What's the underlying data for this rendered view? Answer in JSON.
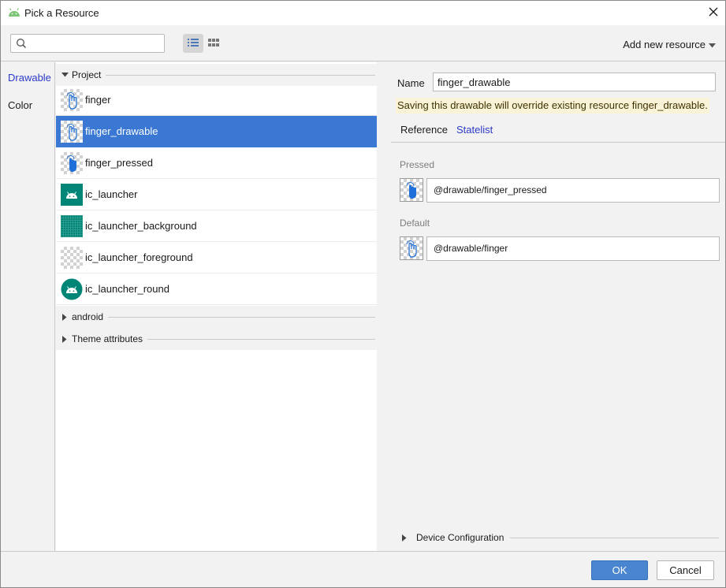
{
  "window": {
    "title": "Pick a Resource",
    "close_icon": "close-icon",
    "app_icon": "android-icon"
  },
  "toolbar": {
    "search": {
      "value": "",
      "placeholder": ""
    },
    "view_list_icon": "list-view-icon",
    "view_grid_icon": "grid-view-icon",
    "add_new_label": "Add new resource"
  },
  "sidebar": {
    "items": [
      {
        "label": "Drawable",
        "selected": true
      },
      {
        "label": "Color",
        "selected": false
      }
    ]
  },
  "resources": {
    "groups": [
      {
        "label": "Project",
        "expanded": true,
        "items": [
          {
            "name": "finger",
            "icon": "finger-outline-icon",
            "selected": false
          },
          {
            "name": "finger_drawable",
            "icon": "finger-outline-icon",
            "selected": true
          },
          {
            "name": "finger_pressed",
            "icon": "finger-pressed-icon",
            "selected": false
          },
          {
            "name": "ic_launcher",
            "icon": "android-launcher-icon",
            "selected": false
          },
          {
            "name": "ic_launcher_background",
            "icon": "grid-background-icon",
            "selected": false
          },
          {
            "name": "ic_launcher_foreground",
            "icon": "transparent-foreground-icon",
            "selected": false
          },
          {
            "name": "ic_launcher_round",
            "icon": "android-round-icon",
            "selected": false
          }
        ]
      },
      {
        "label": "android",
        "expanded": false
      },
      {
        "label": "Theme attributes",
        "expanded": false
      }
    ]
  },
  "detail": {
    "name_label": "Name",
    "name_value": "finger_drawable",
    "warning": "Saving this drawable will override existing resource finger_drawable.",
    "tabs": [
      {
        "label": "Reference",
        "active": false
      },
      {
        "label": "Statelist",
        "active": true
      }
    ],
    "states": [
      {
        "label": "Pressed",
        "value": "@drawable/finger_pressed",
        "icon": "finger-pressed-icon"
      },
      {
        "label": "Default",
        "value": "@drawable/finger",
        "icon": "finger-outline-icon"
      }
    ],
    "device_config_label": "Device Configuration"
  },
  "footer": {
    "ok_label": "OK",
    "cancel_label": "Cancel"
  },
  "colors": {
    "accent": "#3a78d4",
    "link_blue": "#2a39c7",
    "warning_bg": "#fbf3d8",
    "ok_button": "#4a86cf",
    "android_green": "#3ddc84",
    "launcher_teal": "#008577"
  }
}
